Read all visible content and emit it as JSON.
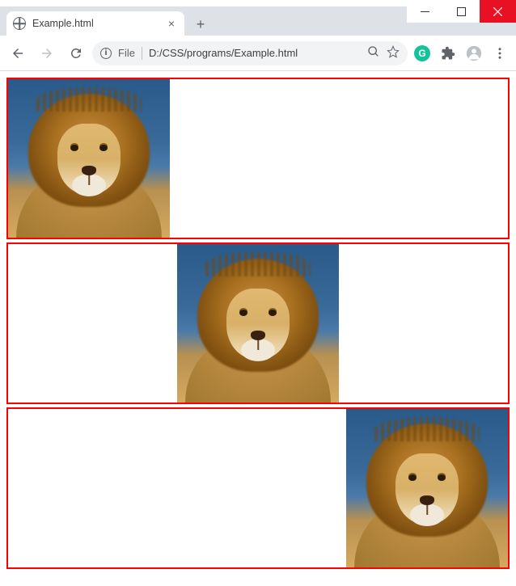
{
  "window": {
    "minimize": "–",
    "maximize": "□",
    "close": "×"
  },
  "tab": {
    "title": "Example.html"
  },
  "toolbar": {
    "file_label": "File",
    "url": "D:/CSS/programs/Example.html",
    "grammarly_label": "G"
  },
  "content": {
    "boxes": [
      {
        "position": "left"
      },
      {
        "position": "center"
      },
      {
        "position": "right"
      }
    ]
  }
}
